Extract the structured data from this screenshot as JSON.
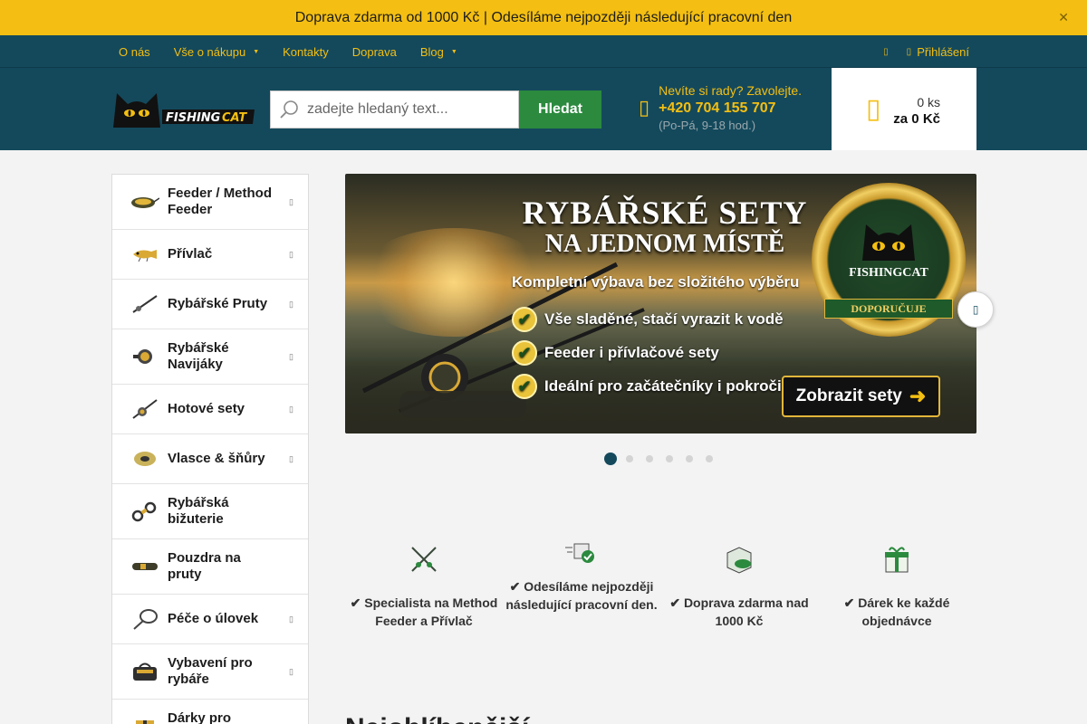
{
  "announcement": {
    "text": "Doprava zdarma od 1000 Kč | Odesíláme nejpozději následující pracovní den",
    "close_icon": "close-icon"
  },
  "nav": {
    "items": [
      {
        "label": "O nás",
        "has_dropdown": false
      },
      {
        "label": "Vše o nákupu",
        "has_dropdown": true
      },
      {
        "label": "Kontakty",
        "has_dropdown": false
      },
      {
        "label": "Doprava",
        "has_dropdown": false
      },
      {
        "label": "Blog",
        "has_dropdown": true
      }
    ],
    "login_label": "Přihlášení",
    "accent": "#f4bf12",
    "background": "#14495c"
  },
  "header": {
    "logo_text": "FISHINGCAT",
    "search": {
      "placeholder": "zadejte hledaný text...",
      "button_label": "Hledat"
    },
    "contact": {
      "question": "Nevíte si rady? Zavolejte.",
      "phone": "+420 704 155 707",
      "hours": "(Po-Pá, 9-18 hod.)"
    },
    "cart": {
      "count": "0 ks",
      "total": "za 0 Kč"
    }
  },
  "sidebar": {
    "categories": [
      {
        "label": "Feeder / Method Feeder",
        "icon": "feeder-icon",
        "has_submenu": true
      },
      {
        "label": "Přívlač",
        "icon": "lure-icon",
        "has_submenu": true
      },
      {
        "label": "Rybářské Pruty",
        "icon": "rod-icon",
        "has_submenu": true
      },
      {
        "label": "Rybářské Navijáky",
        "icon": "reel-icon",
        "has_submenu": true
      },
      {
        "label": "Hotové sety",
        "icon": "set-icon",
        "has_submenu": true
      },
      {
        "label": "Vlasce & šňůry",
        "icon": "line-spool-icon",
        "has_submenu": true
      },
      {
        "label": "Rybářská bižuterie",
        "icon": "swivel-icon",
        "has_submenu": false
      },
      {
        "label": "Pouzdra na pruty",
        "icon": "rod-case-icon",
        "has_submenu": false
      },
      {
        "label": "Péče o úlovek",
        "icon": "landing-net-icon",
        "has_submenu": true
      },
      {
        "label": "Vybavení pro rybáře",
        "icon": "tackle-bag-icon",
        "has_submenu": true
      },
      {
        "label": "Dárky pro",
        "icon": "gift-icon",
        "has_submenu": false
      }
    ]
  },
  "banner": {
    "title_line1": "RYBÁŘSKÉ SETY",
    "title_line2": "NA JEDNOM MÍSTĚ",
    "subtitle": "Kompletní výbava bez složitého výběru",
    "checks": [
      "Vše sladěné, stačí vyrazit k vodě",
      "Feeder i přívlačové sety",
      "Ideální pro začátečníky i pokročilé"
    ],
    "cta": "Zobrazit sety",
    "badge_brand": "FISHINGCAT",
    "badge_ribbon": "DOPORUČUJE",
    "slides_total": 6,
    "active_slide": 1
  },
  "features": [
    {
      "icon": "crossed-rods-icon",
      "text": "✔ Specialista na Method Feeder a Přívlač"
    },
    {
      "icon": "fast-shipping-icon",
      "text": "✔ Odesíláme nejpozději následující pracovní den."
    },
    {
      "icon": "free-delivery-box-icon",
      "text": "✔ Doprava zdarma nad 1000 Kč"
    },
    {
      "icon": "gift-icon",
      "text": "✔ Dárek ke každé objednávce"
    }
  ],
  "section_heading": "Nejoblíbenější"
}
